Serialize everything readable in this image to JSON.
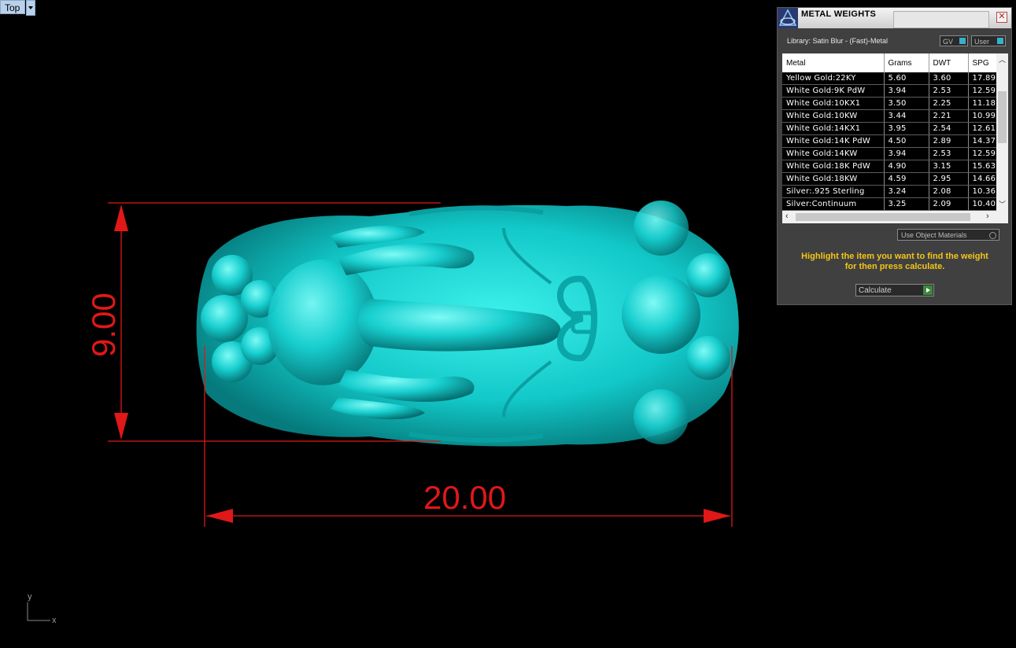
{
  "viewport": {
    "name": "Top"
  },
  "dimensions": {
    "height_label": "9.00",
    "width_label": "20.00",
    "color": "#e01818"
  },
  "model": {
    "color": "#16d0d0"
  },
  "axes": {
    "y": "y",
    "x": "x"
  },
  "panel": {
    "title": "METAL WEIGHTS",
    "library": "Library: Satin Blur - (Fast)-Metal",
    "toggle_gv": "GV",
    "toggle_user": "User",
    "columns": [
      "Metal",
      "Grams",
      "DWT",
      "SPG"
    ],
    "rows": [
      [
        "Yellow Gold:22KY",
        "5.60",
        "3.60",
        "17.89"
      ],
      [
        "White Gold:9K PdW",
        "3.94",
        "2.53",
        "12.59"
      ],
      [
        "White Gold:10KX1",
        "3.50",
        "2.25",
        "11.18"
      ],
      [
        "White Gold:10KW",
        "3.44",
        "2.21",
        "10.99"
      ],
      [
        "White Gold:14KX1",
        "3.95",
        "2.54",
        "12.61"
      ],
      [
        "White Gold:14K PdW",
        "4.50",
        "2.89",
        "14.37"
      ],
      [
        "White Gold:14KW",
        "3.94",
        "2.53",
        "12.59"
      ],
      [
        "White Gold:18K PdW",
        "4.90",
        "3.15",
        "15.63"
      ],
      [
        "White Gold:18KW",
        "4.59",
        "2.95",
        "14.66"
      ],
      [
        "Silver:.925 Sterling",
        "3.24",
        "2.08",
        "10.36"
      ],
      [
        "Silver:Continuum",
        "3.25",
        "2.09",
        "10.40"
      ]
    ],
    "use_object_materials": "Use Object Materials",
    "hint_line1": "Highlight the item you want to find the weight",
    "hint_line2": "for then press calculate.",
    "calculate": "Calculate",
    "accent": "#f5c518"
  }
}
